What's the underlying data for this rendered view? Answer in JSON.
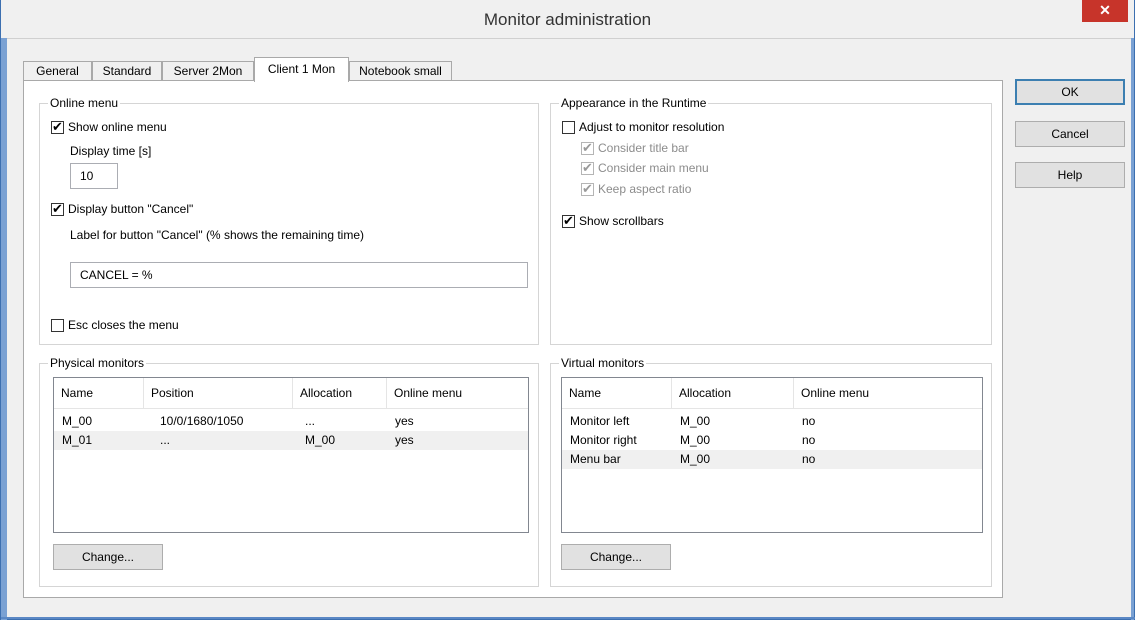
{
  "window": {
    "title": "Monitor administration",
    "close_glyph": "✕"
  },
  "tabs": [
    {
      "label": "General"
    },
    {
      "label": "Standard"
    },
    {
      "label": "Server 2Mon"
    },
    {
      "label": "Client 1 Mon",
      "active": true
    },
    {
      "label": "Notebook small"
    }
  ],
  "online_menu": {
    "legend": "Online menu",
    "show_online_menu": {
      "label": "Show online menu",
      "checked": true
    },
    "display_time_label": "Display time [s]",
    "display_time_value": "10",
    "display_cancel": {
      "label": "Display button \"Cancel\"",
      "checked": true
    },
    "cancel_label_text": "Label for button \"Cancel\" (% shows the remaining time)",
    "cancel_label_value": "CANCEL = %",
    "esc_closes": {
      "label": "Esc closes the menu",
      "checked": false
    }
  },
  "appearance": {
    "legend": "Appearance in the Runtime",
    "adjust_resolution": {
      "label": "Adjust to monitor resolution",
      "checked": false
    },
    "consider_title_bar": {
      "label": "Consider title bar",
      "checked": true,
      "disabled": true
    },
    "consider_main_menu": {
      "label": "Consider main menu",
      "checked": true,
      "disabled": true
    },
    "keep_aspect_ratio": {
      "label": "Keep aspect ratio",
      "checked": true,
      "disabled": true
    },
    "show_scrollbars": {
      "label": "Show scrollbars",
      "checked": true
    }
  },
  "physical": {
    "legend": "Physical monitors",
    "columns": [
      "Name",
      "Position",
      "Allocation",
      "Online menu"
    ],
    "rows": [
      [
        "M_00",
        "10/0/1680/1050",
        "...",
        "yes"
      ],
      [
        "M_01",
        "...",
        "M_00",
        "yes"
      ]
    ],
    "change_label": "Change..."
  },
  "virtual": {
    "legend": "Virtual monitors",
    "columns": [
      "Name",
      "Allocation",
      "Online menu"
    ],
    "rows": [
      [
        "Monitor left",
        "M_00",
        "no"
      ],
      [
        "Monitor right",
        "M_00",
        "no"
      ],
      [
        "Menu bar",
        "M_00",
        "no"
      ]
    ],
    "change_label": "Change..."
  },
  "buttons": {
    "ok": "OK",
    "cancel": "Cancel",
    "help": "Help"
  }
}
